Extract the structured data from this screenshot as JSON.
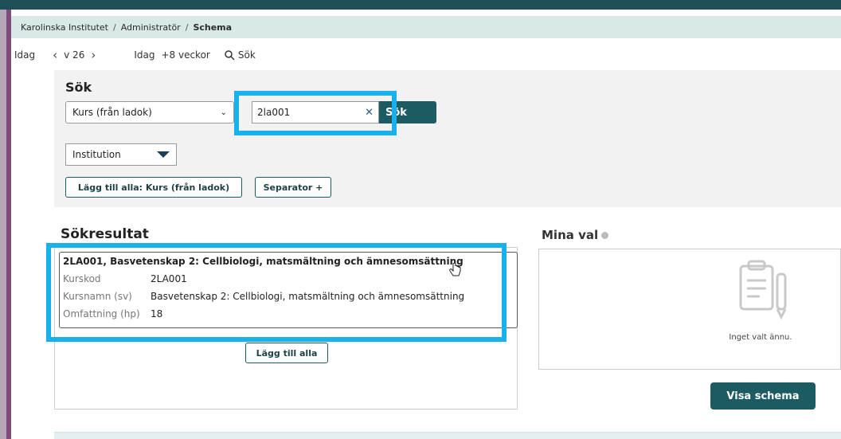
{
  "breadcrumb": {
    "items": [
      "Karolinska Institutet",
      "Administratör"
    ],
    "current": "Schema"
  },
  "nav": {
    "today": "Idag",
    "week": "v 26",
    "today2": "Idag",
    "plus_weeks": "+8 veckor",
    "search": "Sök"
  },
  "search": {
    "heading": "Sök",
    "type_select": "Kurs (från ladok)",
    "query": "2la001",
    "button": "Sök",
    "institution": "Institution",
    "add_all": "Lägg till alla: Kurs (från ladok)",
    "separator": "Separator +"
  },
  "results": {
    "heading": "Sökresultat",
    "item": {
      "title": "2LA001, Basvetenskap 2: Cellbiologi, matsmältning och ämnesomsättning",
      "fields": [
        {
          "label": "Kurskod",
          "value": "2LA001"
        },
        {
          "label": "Kursnamn (sv)",
          "value": "Basvetenskap 2: Cellbiologi, matsmältning och ämnesomsättning"
        },
        {
          "label": "Omfattning (hp)",
          "value": "18"
        }
      ]
    },
    "add_all": "Lägg till alla"
  },
  "mina_val": {
    "heading": "Mina val",
    "empty": "Inget valt ännu.",
    "show_button": "Visa schema"
  }
}
